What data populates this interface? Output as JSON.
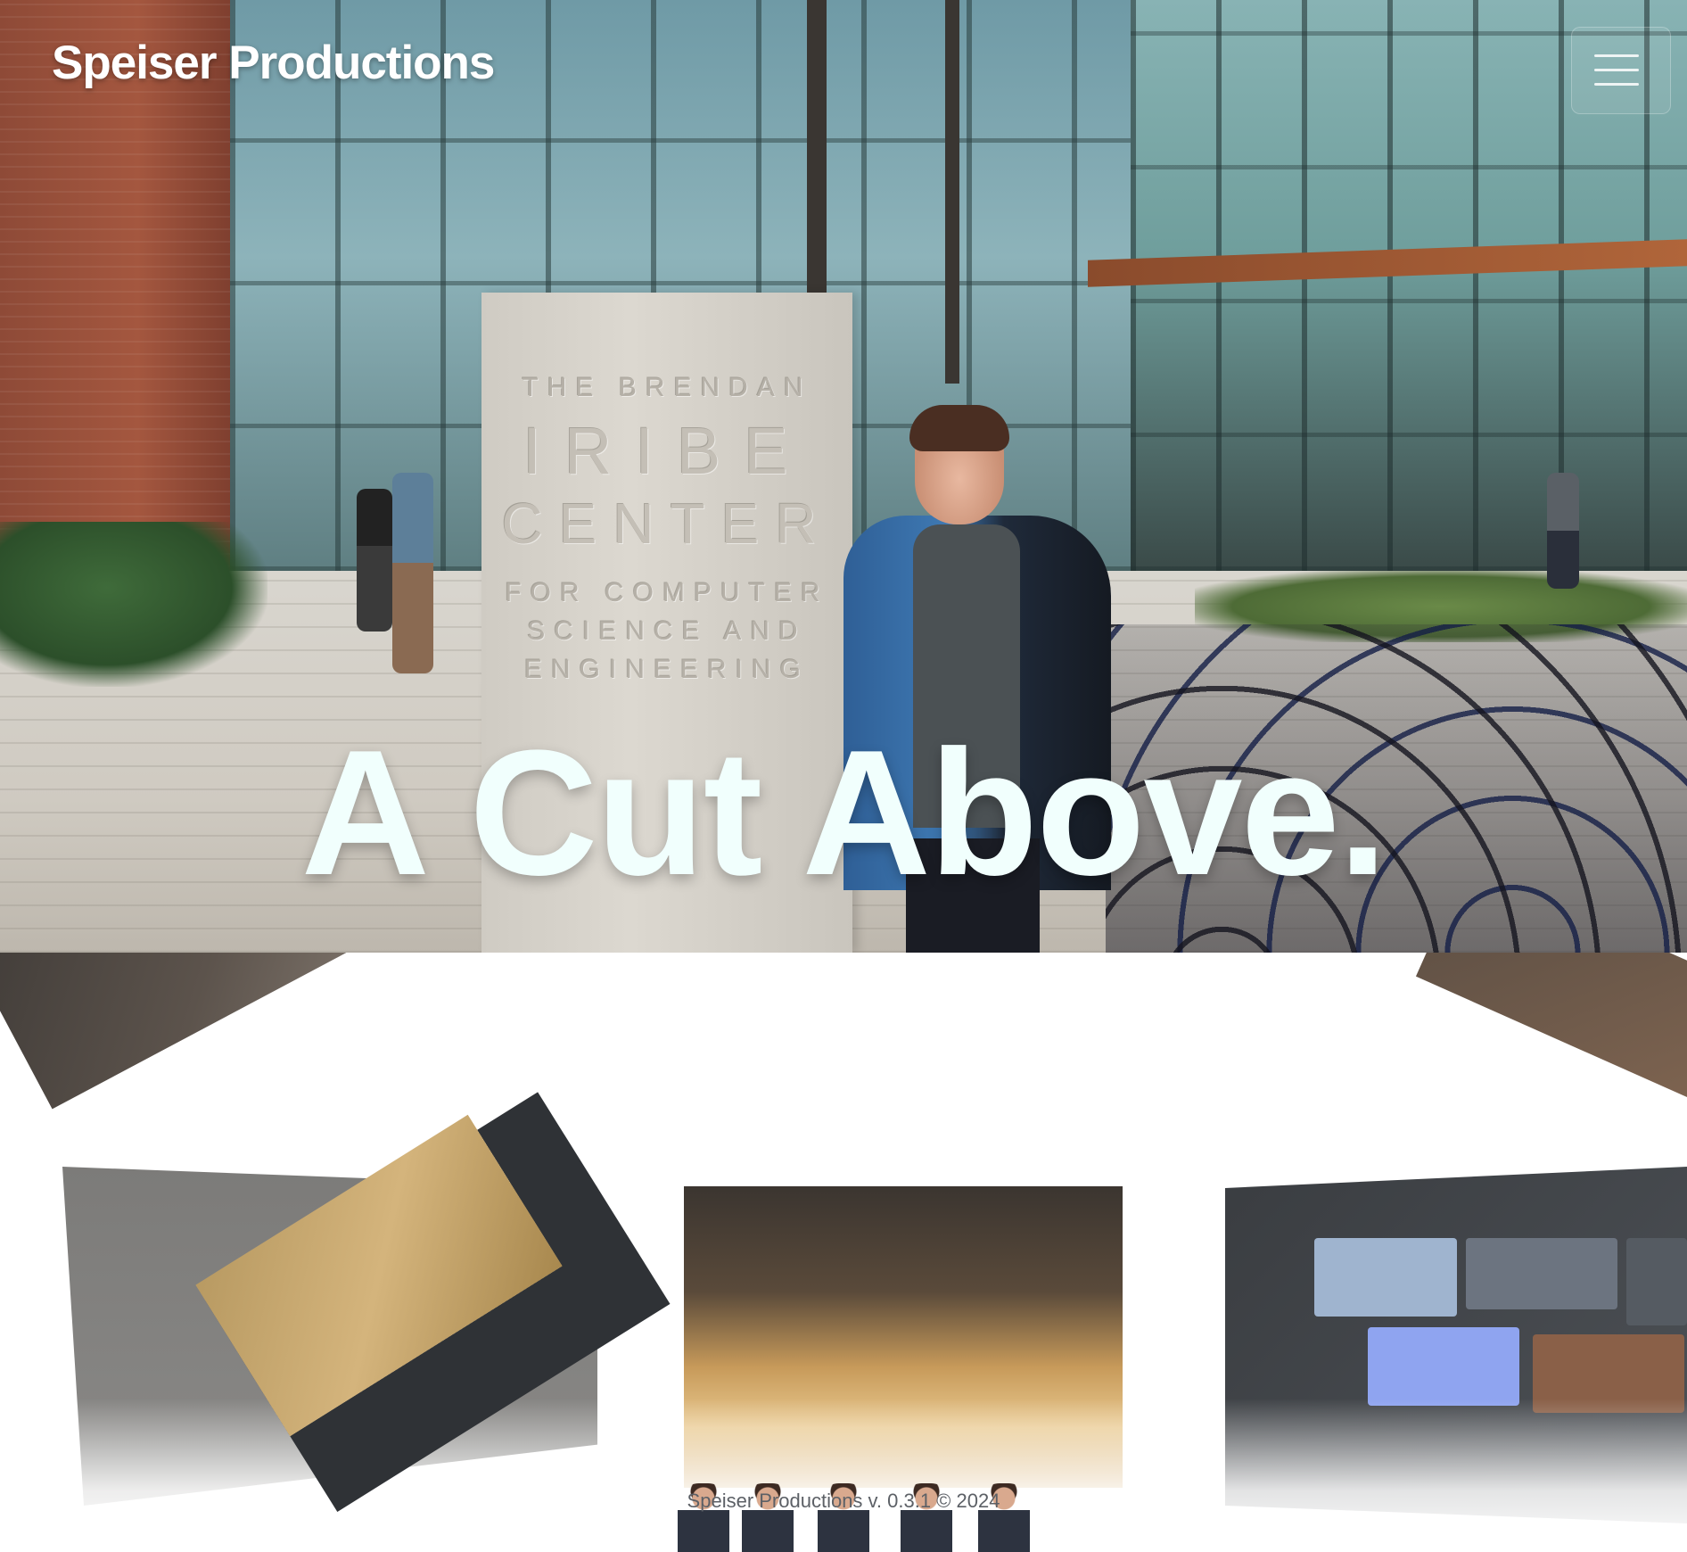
{
  "header": {
    "brand": "Speiser Productions",
    "menu_icon": "hamburger-menu-icon"
  },
  "hero": {
    "tagline": "A Cut Above.",
    "sign": {
      "line1": "THE BRENDAN",
      "line2": "IRIBE",
      "line3": "CENTER",
      "line4": "FOR COMPUTER",
      "line5": "SCIENCE AND",
      "line6": "ENGINEERING"
    }
  },
  "footer": {
    "text": "Speiser Productions v. 0.3.1 © 2024"
  },
  "colors": {
    "tagline": "#f1fffd",
    "brand": "#ffffff",
    "footer_text": "#5c6066"
  }
}
